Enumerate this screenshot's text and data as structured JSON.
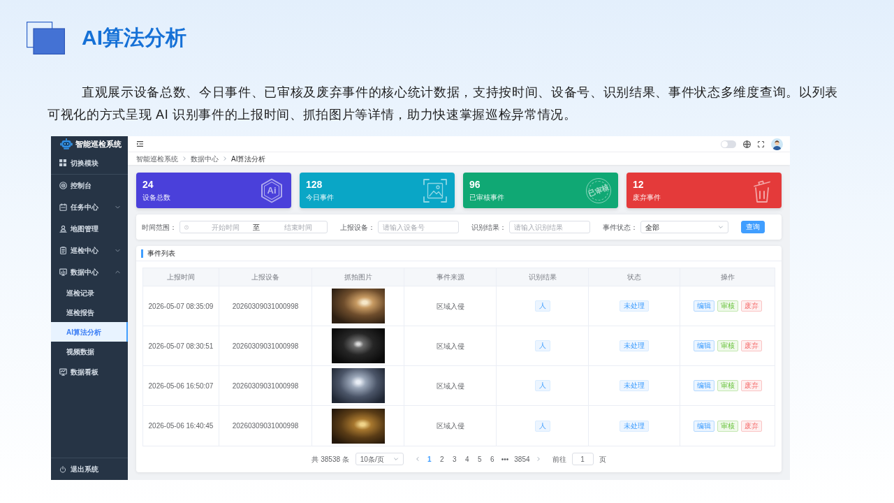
{
  "slide": {
    "title": "AI算法分析",
    "description": "直观展示设备总数、今日事件、已审核及废弃事件的核心统计数据，支持按时间、设备号、识别结果、事件状态多维度查询。以列表可视化的方式呈现 AI 识别事件的上报时间、抓拍图片等详情，助力快速掌握巡检异常情况。"
  },
  "app": {
    "sidebar": {
      "logo": "智能巡检系统",
      "switch_module": "切换模块",
      "items": [
        {
          "label": "控制台",
          "selected": false
        },
        {
          "label": "任务中心",
          "selected": false,
          "expanded": false
        },
        {
          "label": "地图管理",
          "selected": false
        },
        {
          "label": "巡检中心",
          "selected": false,
          "expanded": false
        },
        {
          "label": "数据中心",
          "selected": false,
          "expanded": true,
          "children": [
            {
              "label": "巡检记录",
              "selected": false
            },
            {
              "label": "巡检报告",
              "selected": false
            },
            {
              "label": "AI算法分析",
              "selected": true
            },
            {
              "label": "视频数据",
              "selected": false
            }
          ]
        },
        {
          "label": "数据看板",
          "selected": false
        }
      ],
      "logout": "退出系统"
    },
    "header": {
      "switch": {
        "on": false
      }
    },
    "breadcrumb": [
      "智能巡检系统",
      "数据中心",
      "AI算法分析"
    ],
    "stats": [
      {
        "value": "24",
        "label": "设备总数",
        "color": "#4a40da",
        "badge": "Ai"
      },
      {
        "value": "128",
        "label": "今日事件",
        "color": "#0aa6c6"
      },
      {
        "value": "96",
        "label": "已审核事件",
        "color": "#10a874",
        "badge": "已审核"
      },
      {
        "value": "12",
        "label": "废弃事件",
        "color": "#e43a3a"
      }
    ],
    "filters": {
      "time_range": {
        "label": "时间范围：",
        "start_placeholder": "开始时间",
        "separator": "至",
        "end_placeholder": "结束时间"
      },
      "device": {
        "label": "上报设备：",
        "placeholder": "请输入设备号"
      },
      "result": {
        "label": "识别结果：",
        "placeholder": "请输入识别结果"
      },
      "status": {
        "label": "事件状态：",
        "value": "全部"
      },
      "search_button": "查询"
    },
    "event_list": {
      "title": "事件列表",
      "columns": [
        "上报时间",
        "上报设备",
        "抓拍图片",
        "事件来源",
        "识别结果",
        "状态",
        "操作"
      ],
      "rows": [
        {
          "time": "2026-05-07 08:35:09",
          "device": "20260309031000998",
          "source": "区域入侵",
          "result": "人",
          "status": "未处理",
          "actions": [
            {
              "label": "编辑",
              "kind": "edit"
            },
            {
              "label": "审核",
              "kind": "review"
            },
            {
              "label": "废弃",
              "kind": "discard"
            }
          ]
        },
        {
          "time": "2026-05-07 08:30:51",
          "device": "20260309031000998",
          "source": "区域入侵",
          "result": "人",
          "status": "未处理",
          "actions": [
            {
              "label": "编辑",
              "kind": "edit"
            },
            {
              "label": "审核",
              "kind": "review"
            },
            {
              "label": "废弃",
              "kind": "discard"
            }
          ]
        },
        {
          "time": "2026-05-06 16:50:07",
          "device": "20260309031000998",
          "source": "区域入侵",
          "result": "人",
          "status": "未处理",
          "actions": [
            {
              "label": "编辑",
              "kind": "edit"
            },
            {
              "label": "审核",
              "kind": "review"
            },
            {
              "label": "废弃",
              "kind": "discard"
            }
          ]
        },
        {
          "time": "2026-05-06 16:40:45",
          "device": "20260309031000998",
          "source": "区域入侵",
          "result": "人",
          "status": "未处理",
          "actions": [
            {
              "label": "编辑",
              "kind": "edit"
            },
            {
              "label": "审核",
              "kind": "review"
            },
            {
              "label": "废弃",
              "kind": "discard"
            }
          ]
        }
      ]
    },
    "pagination": {
      "total": "共 38538 条",
      "page_size": "10条/页",
      "pages": [
        {
          "label": "1",
          "selected": true
        },
        {
          "label": "2",
          "selected": false
        },
        {
          "label": "3",
          "selected": false
        },
        {
          "label": "4",
          "selected": false
        },
        {
          "label": "5",
          "selected": false
        },
        {
          "label": "6",
          "selected": false
        },
        {
          "label": "•••",
          "selected": false
        },
        {
          "label": "3854",
          "selected": false
        }
      ],
      "goto_label": "前往",
      "goto_value": "1",
      "page_suffix": "页"
    }
  }
}
